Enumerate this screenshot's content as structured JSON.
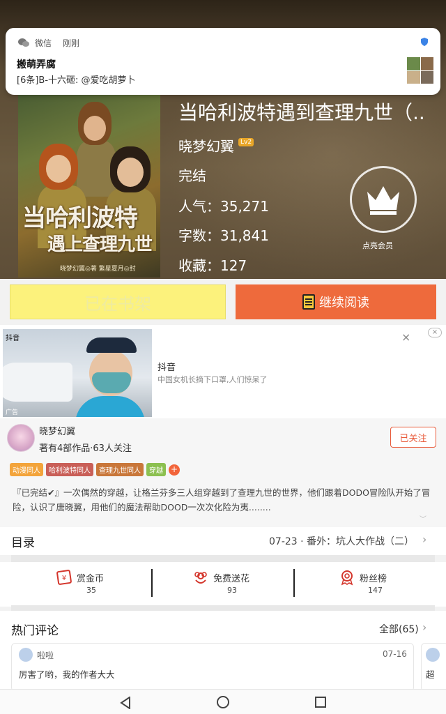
{
  "notification": {
    "app_name": "微信",
    "time": "刚刚",
    "title": "搬萌弄腐",
    "body": "[6条]B-十六砸: @爱吃胡萝卜"
  },
  "book": {
    "cover_title_line1": "当哈利波特",
    "cover_title_line2": "遇上查理九世",
    "cover_credit": "晓梦幻翼◎著  繁星夏月◎封",
    "title": "当哈利波特遇到查理九世（..",
    "author": "晓梦幻翼",
    "level_badge": "Lv2",
    "status": "完结",
    "popularity": "人气：35,271",
    "word_count": "字数：31,841",
    "favorites": "收藏：127",
    "vip_label": "点亮会员"
  },
  "actions": {
    "shelf_label": "已在书架",
    "read_label": "继续阅读"
  },
  "ad": {
    "source": "抖音",
    "title": "抖音",
    "description": "中国女机长摘下口罩,人们惊呆了",
    "ad_tag": "广告"
  },
  "author_section": {
    "name": "晓梦幻翼",
    "stats": "著有4部作品·63人关注",
    "follow_label": "已关注",
    "tags": [
      {
        "label": "动漫同人",
        "color": "#f3a43b"
      },
      {
        "label": "哈利波特同人",
        "color": "#c95f58"
      },
      {
        "label": "查理九世同人",
        "color": "#c9773a"
      },
      {
        "label": "穿越",
        "color": "#8cc050"
      }
    ],
    "tag_more": "+",
    "description": "『已完结✔』一次偶然的穿越，让格兰芬多三人组穿越到了查理九世的世界，他们跟着DODO冒险队开始了冒险，认识了唐晓翼，用他们的魔法帮助DOOD一次次化险为夷........"
  },
  "toc": {
    "title": "目录",
    "latest": "07-23 · 番外：坑人大作战（二）"
  },
  "stats": [
    {
      "label": "赏金币",
      "value": "35",
      "icon": "coin-icon"
    },
    {
      "label": "免费送花",
      "value": "93",
      "icon": "flower-icon"
    },
    {
      "label": "粉丝榜",
      "value": "147",
      "icon": "medal-icon"
    }
  ],
  "comments": {
    "title": "热门评论",
    "all_label": "全部(65)",
    "items": [
      {
        "user": "啦啦",
        "date": "07-16",
        "text": "厉害了哟，我的作者大大"
      },
      {
        "text": "超"
      }
    ]
  },
  "colors": {
    "accent": "#ee6a3c",
    "shelf": "#fcf27c"
  }
}
